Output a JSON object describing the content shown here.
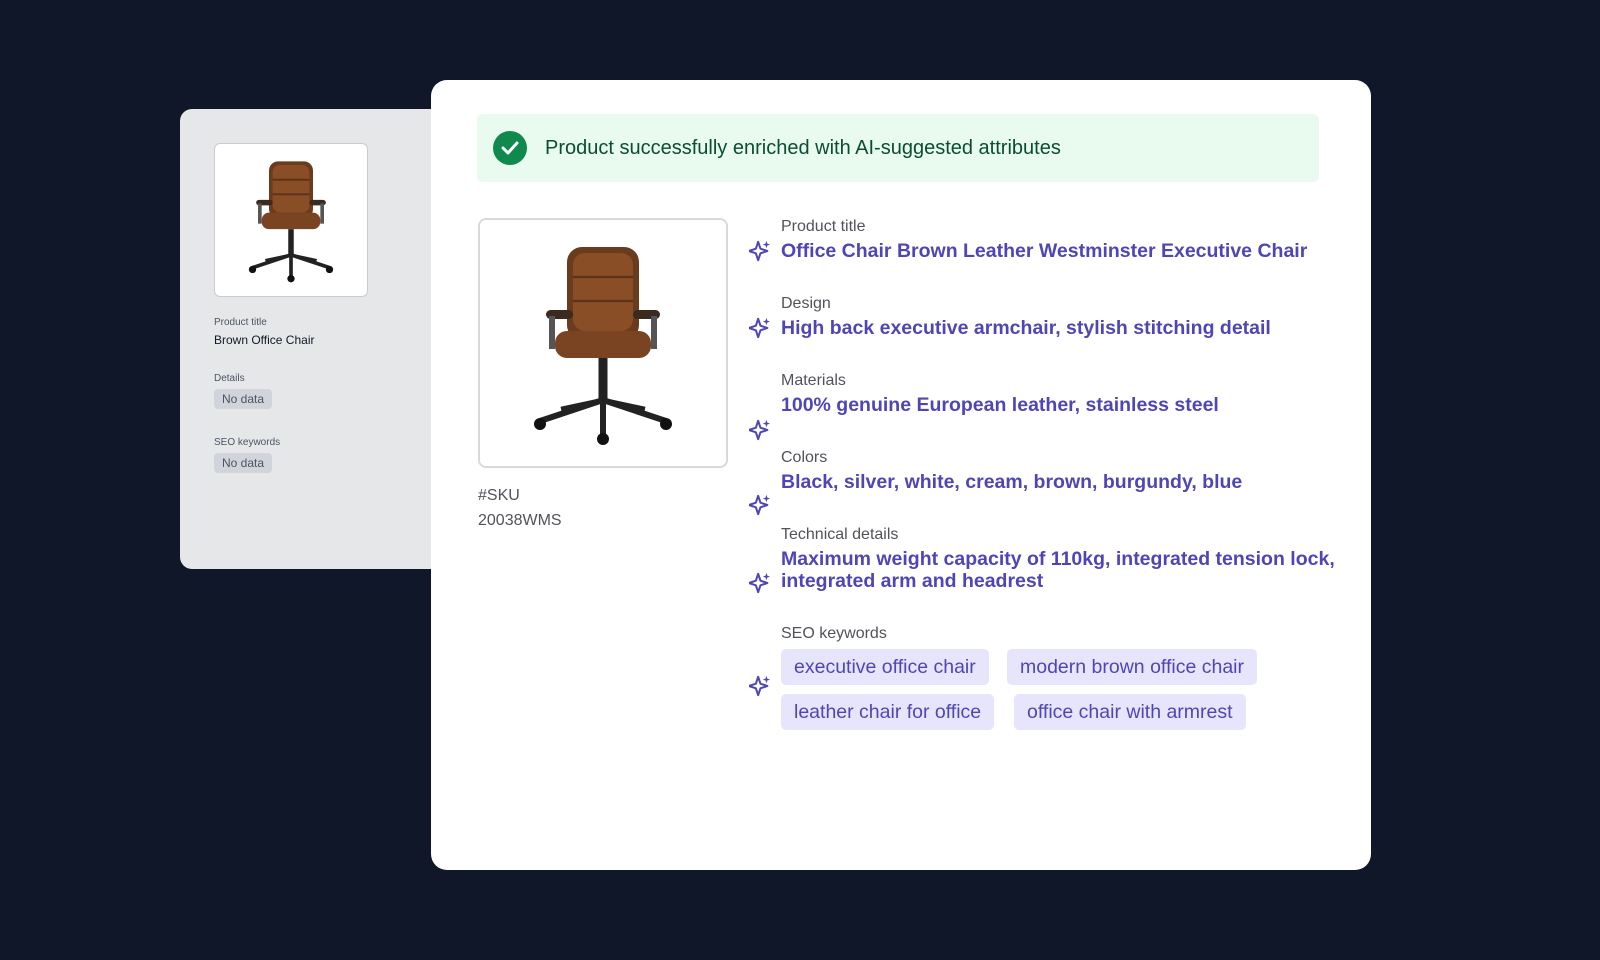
{
  "back_card": {
    "product_title_label": "Product title",
    "product_title_value": "Brown Office Chair",
    "details_label": "Details",
    "details_value": "No data",
    "seo_label": "SEO keywords",
    "seo_value": "No data"
  },
  "banner": {
    "message": "Product successfully enriched with AI-suggested attributes",
    "icon": "check-circle-icon",
    "color": "#0f8a4c"
  },
  "product": {
    "sku_label": "#SKU",
    "sku_value": "20038WMS",
    "image": "office-chair-image"
  },
  "attributes": [
    {
      "label": "Product title",
      "value": "Office Chair Brown Leather Westminster Executive Chair"
    },
    {
      "label": "Design",
      "value": "High back executive armchair, stylish stitching detail"
    },
    {
      "label": "Materials",
      "value": "100% genuine European leather, stainless steel"
    },
    {
      "label": "Colors",
      "value": "Black, silver, white, cream, brown, burgundy, blue"
    },
    {
      "label": "Technical details",
      "value": "Maximum weight capacity of 110kg, integrated tension lock, integrated arm and headrest"
    }
  ],
  "seo": {
    "label": "SEO keywords",
    "keywords": [
      "executive office chair",
      "modern brown office chair",
      "leather chair for office",
      "office chair with armrest"
    ]
  },
  "colors": {
    "background": "#0f1729",
    "accent": "#4f46b5",
    "success": "#0f8a4c"
  }
}
